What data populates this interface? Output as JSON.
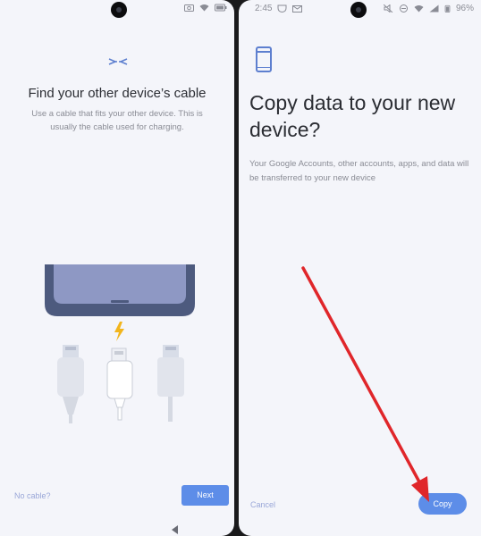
{
  "left_screen": {
    "title": "Find your other device’s cable",
    "subtitle": "Use a cable that fits your other device. This is usually the cable used for charging.",
    "no_cable_label": "No cable?",
    "next_label": "Next"
  },
  "right_screen": {
    "status_time": "2:45",
    "battery": "96%",
    "title": "Copy data to your new device?",
    "subtitle": "Your Google Accounts, other accounts, apps, and data will be transferred to your new device",
    "cancel_label": "Cancel",
    "copy_label": "Copy"
  },
  "colors": {
    "accent": "#5d8de8",
    "arrow": "#e0262a",
    "background": "#f4f5fa"
  },
  "icons": [
    "cable-connect-icon",
    "phone-icon",
    "lightning-icon",
    "usb-c-cable-icon",
    "wifi-icon",
    "battery-icon",
    "back-nav-icon"
  ]
}
